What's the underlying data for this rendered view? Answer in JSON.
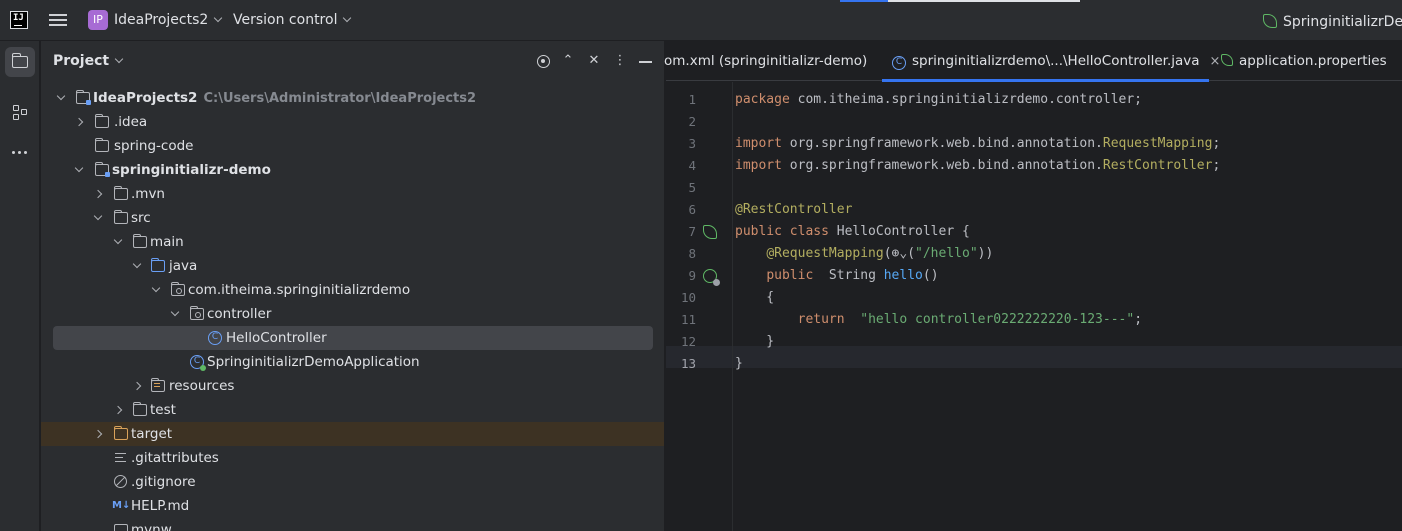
{
  "titlebar": {
    "logo_text": "IJ",
    "project_badge": "IP",
    "project_name": "IdeaProjects2",
    "vcs_label": "Version control",
    "run_config": "SpringinitializrDemo"
  },
  "stripe": {
    "icons": [
      "project-folder-icon",
      "structure-icon",
      "more-icon"
    ]
  },
  "project_panel": {
    "title": "Project",
    "tools": [
      "locate-icon",
      "expand-collapse-icon",
      "close-all-icon",
      "kebab-menu-icon",
      "minimize-icon"
    ],
    "tree": [
      {
        "label": "IdeaProjects2",
        "hint": "C:\\Users\\Administrator\\IdeaProjects2",
        "expanded": true
      },
      {
        "label": ".idea",
        "expanded": false
      },
      {
        "label": "spring-code"
      },
      {
        "label": "springinitializr-demo",
        "expanded": true
      },
      {
        "label": ".mvn",
        "expanded": false
      },
      {
        "label": "src",
        "expanded": true
      },
      {
        "label": "main",
        "expanded": true
      },
      {
        "label": "java",
        "expanded": true
      },
      {
        "label": "com.itheima.springinitializrdemo",
        "expanded": true
      },
      {
        "label": "controller",
        "expanded": true
      },
      {
        "label": "HelloController",
        "selected": true
      },
      {
        "label": "SpringinitializrDemoApplication"
      },
      {
        "label": "resources",
        "expanded": false
      },
      {
        "label": "test",
        "expanded": false
      },
      {
        "label": "target",
        "expanded": false
      },
      {
        "label": ".gitattributes"
      },
      {
        "label": ".gitignore"
      },
      {
        "label": "HELP.md",
        "icon_text": "M↓"
      },
      {
        "label": "mvnw"
      }
    ]
  },
  "editor": {
    "tabs": [
      {
        "label": "om.xml (springinitializr-demo)"
      },
      {
        "label": "springinitializrdemo\\...\\HelloController.java",
        "active": true,
        "close": "×"
      },
      {
        "label": "application.properties"
      }
    ],
    "lines": [
      {
        "n": "1",
        "parts": [
          [
            "kw",
            "package"
          ],
          [
            "plain",
            " com.itheima.springinitializrdemo.controller;"
          ]
        ]
      },
      {
        "n": "2",
        "parts": []
      },
      {
        "n": "3",
        "parts": [
          [
            "kw",
            "import"
          ],
          [
            "plain",
            " org.springframework.web.bind.annotation."
          ],
          [
            "ann",
            "RequestMapping"
          ],
          [
            "plain",
            ";"
          ]
        ]
      },
      {
        "n": "4",
        "parts": [
          [
            "kw",
            "import"
          ],
          [
            "plain",
            " org.springframework.web.bind.annotation."
          ],
          [
            "ann",
            "RestController"
          ],
          [
            "plain",
            ";"
          ]
        ]
      },
      {
        "n": "5",
        "parts": []
      },
      {
        "n": "6",
        "parts": [
          [
            "ann",
            "@RestController"
          ]
        ]
      },
      {
        "n": "7",
        "parts": [
          [
            "kw",
            "public class"
          ],
          [
            "plain",
            " HelloController {"
          ]
        ],
        "gutter": "leaf"
      },
      {
        "n": "8",
        "parts": [
          [
            "plain",
            "    "
          ],
          [
            "ann",
            "@RequestMapping"
          ],
          [
            "plain",
            "("
          ],
          [
            "plain",
            "⊕⌄"
          ],
          [
            "plain",
            "("
          ],
          [
            "str",
            "\"/hello\""
          ],
          [
            "plain",
            "))"
          ]
        ]
      },
      {
        "n": "9",
        "parts": [
          [
            "plain",
            "    "
          ],
          [
            "kw",
            "public"
          ],
          [
            "plain",
            "  String "
          ],
          [
            "fn",
            "hello"
          ],
          [
            "plain",
            "()"
          ]
        ],
        "gutter": "globe"
      },
      {
        "n": "10",
        "parts": [
          [
            "plain",
            "    {"
          ]
        ]
      },
      {
        "n": "11",
        "parts": [
          [
            "plain",
            "        "
          ],
          [
            "kw",
            "return"
          ],
          [
            "plain",
            "  "
          ],
          [
            "str",
            "\"hello controller0222222220-123---\""
          ],
          [
            "plain",
            ";"
          ]
        ]
      },
      {
        "n": "12",
        "parts": [
          [
            "plain",
            "    }"
          ]
        ]
      },
      {
        "n": "13",
        "parts": [
          [
            "plain",
            "}"
          ]
        ],
        "current": true
      }
    ]
  },
  "colors": {
    "accent": "#3574f0",
    "keyword": "#cf8e6d",
    "annotation": "#b3ae60",
    "string": "#6aab73",
    "method": "#56a8f5"
  }
}
